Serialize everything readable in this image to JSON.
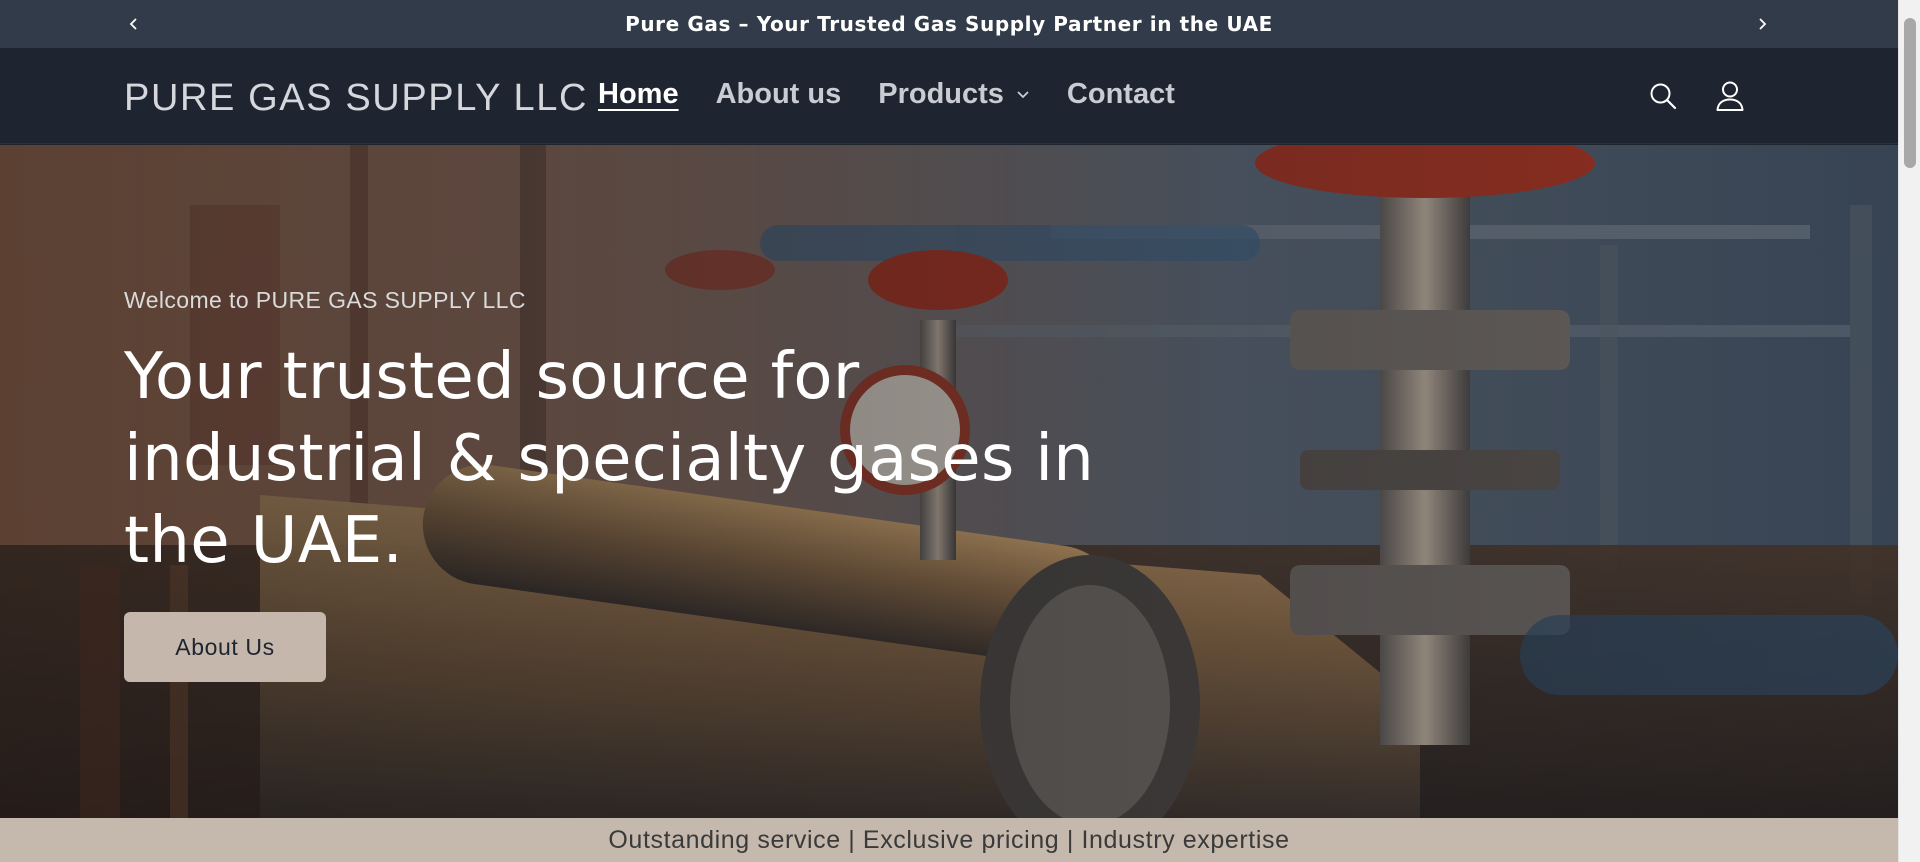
{
  "announcement": {
    "text": "Pure Gas – Your Trusted Gas Supply Partner in the UAE",
    "prev_icon": "chevron-left-icon",
    "next_icon": "chevron-right-icon"
  },
  "header": {
    "logo": "PURE GAS SUPPLY LLC",
    "nav": [
      {
        "label": "Home",
        "active": true
      },
      {
        "label": "About us",
        "active": false
      },
      {
        "label": "Products",
        "active": false,
        "has_dropdown": true
      },
      {
        "label": "Contact",
        "active": false
      }
    ],
    "icons": [
      "search-icon",
      "account-icon"
    ]
  },
  "hero": {
    "kicker": "Welcome to PURE GAS SUPPLY LLC",
    "title": "Your trusted source for industrial & specialty gases in the UAE.",
    "button_label": "About Us"
  },
  "strip": {
    "text": "Outstanding service | Exclusive pricing | Industry expertise"
  },
  "colors": {
    "announcement_bg": "#323b49",
    "header_bg": "#1f2530",
    "button_bg": "#c5b7ac",
    "strip_bg": "#c5b8ad"
  }
}
